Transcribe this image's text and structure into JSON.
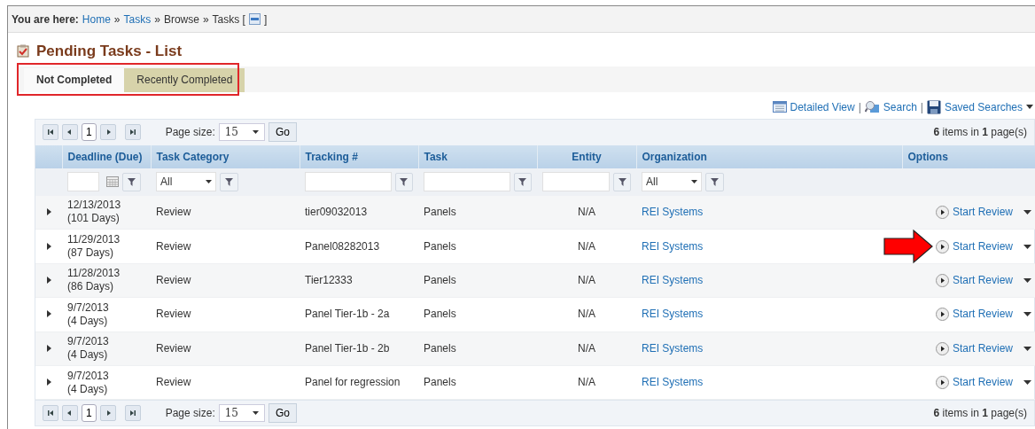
{
  "breadcrumb": {
    "prefix": "You are here:",
    "items": [
      {
        "kind": "link",
        "text": "Home"
      },
      {
        "kind": "sep",
        "text": "»"
      },
      {
        "kind": "link",
        "text": "Tasks"
      },
      {
        "kind": "sep",
        "text": "»"
      },
      {
        "kind": "text",
        "text": "Browse"
      },
      {
        "kind": "sep",
        "text": "»"
      },
      {
        "kind": "text",
        "text": "Tasks ["
      },
      {
        "kind": "icon"
      },
      {
        "kind": "text",
        "text": "]"
      }
    ]
  },
  "title": "Pending Tasks - List",
  "tabs": [
    {
      "label": "Not Completed",
      "selected": true
    },
    {
      "label": "Recently Completed",
      "selected": false
    }
  ],
  "toolbar": [
    {
      "kind": "link",
      "label": "Detailed View"
    },
    {
      "kind": "sep",
      "label": "|"
    },
    {
      "kind": "link",
      "label": "Search"
    },
    {
      "kind": "sep",
      "label": "|"
    },
    {
      "kind": "menu",
      "label": "Saved Searches"
    }
  ],
  "pager_top": {
    "page": "1",
    "size_label": "Page size:",
    "size": "15",
    "go": "Go",
    "summary": "**6** items in **1** page(s)"
  },
  "columns": [
    {
      "label": "Deadline (Due)",
      "kind": "date"
    },
    {
      "label": "Task Category",
      "kind": "select",
      "value": "All"
    },
    {
      "label": "Tracking #",
      "kind": "text"
    },
    {
      "label": "Task",
      "kind": "text"
    },
    {
      "label": "Entity",
      "kind": "text"
    },
    {
      "label": "Organization",
      "kind": "select",
      "value": "All"
    },
    {
      "label": "Options",
      "kind": "none"
    }
  ],
  "rows": [
    {
      "date": "12/13/2013",
      "days": "(101 Days)",
      "category": "Review",
      "tracking": "tier09032013",
      "task": "Panels",
      "entity": "N/A",
      "organization": "REI Systems",
      "action": "Start Review",
      "marked": false
    },
    {
      "date": "11/29/2013",
      "days": "(87 Days)",
      "category": "Review",
      "tracking": "Panel08282013",
      "task": "Panels",
      "entity": "N/A",
      "organization": "REI Systems",
      "action": "Start Review",
      "marked": true
    },
    {
      "date": "11/28/2013",
      "days": "(86 Days)",
      "category": "Review",
      "tracking": "Tier12333",
      "task": "Panels",
      "entity": "N/A",
      "organization": "REI Systems",
      "action": "Start Review",
      "marked": false
    },
    {
      "date": "9/7/2013",
      "days": "(4 Days)",
      "category": "Review",
      "tracking": "Panel Tier-1b - 2a",
      "task": "Panels",
      "entity": "N/A",
      "organization": "REI Systems",
      "action": "Start Review",
      "marked": false
    },
    {
      "date": "9/7/2013",
      "days": "(4 Days)",
      "category": "Review",
      "tracking": "Panel Tier-1b - 2b",
      "task": "Panels",
      "entity": "N/A",
      "organization": "REI Systems",
      "action": "Start Review",
      "marked": false
    },
    {
      "date": "9/7/2013",
      "days": "(4 Days)",
      "category": "Review",
      "tracking": "Panel for regression",
      "task": "Panels",
      "entity": "N/A",
      "organization": "REI Systems",
      "action": "Start Review",
      "marked": false
    }
  ],
  "pager_bottom": {
    "page": "1",
    "size_label": "Page size:",
    "size": "15",
    "go": "Go",
    "summary": "**6** items in **1** page(s)"
  }
}
